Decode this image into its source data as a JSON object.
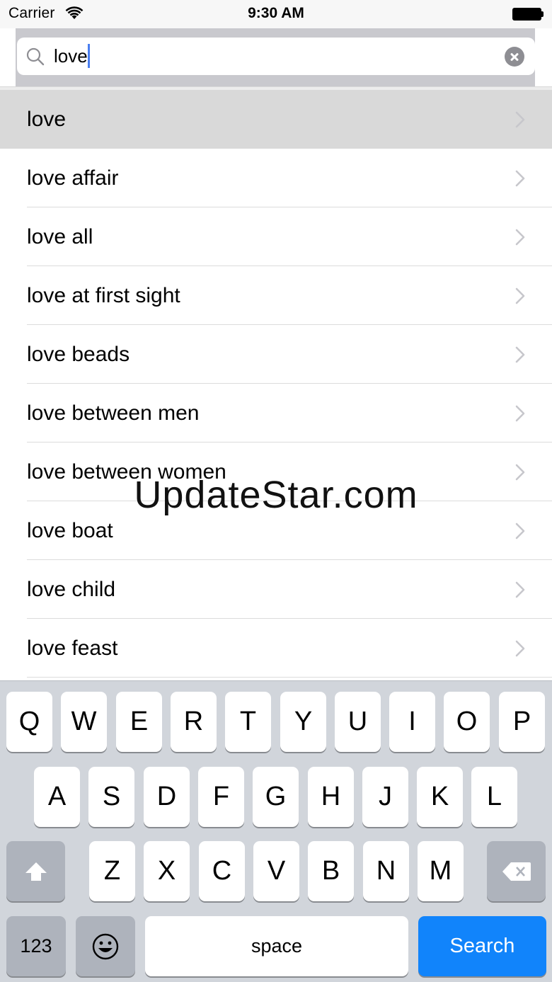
{
  "status_bar": {
    "carrier": "Carrier",
    "time": "9:30 AM"
  },
  "search": {
    "query": "love"
  },
  "suggestions": [
    {
      "label": "love",
      "selected": true
    },
    {
      "label": "love affair"
    },
    {
      "label": "love all"
    },
    {
      "label": "love at first sight"
    },
    {
      "label": "love beads"
    },
    {
      "label": "love between men"
    },
    {
      "label": "love between women"
    },
    {
      "label": "love boat"
    },
    {
      "label": "love child"
    },
    {
      "label": "love feast"
    }
  ],
  "watermark": "UpdateStar.com",
  "keyboard": {
    "row1": [
      "Q",
      "W",
      "E",
      "R",
      "T",
      "Y",
      "U",
      "I",
      "O",
      "P"
    ],
    "row2": [
      "A",
      "S",
      "D",
      "F",
      "G",
      "H",
      "J",
      "K",
      "L"
    ],
    "row3": [
      "Z",
      "X",
      "C",
      "V",
      "B",
      "N",
      "M"
    ],
    "numbers_label": "123",
    "space_label": "space",
    "search_label": "Search"
  },
  "colors": {
    "accent": "#1184fb",
    "selected_row": "#d9d9d9",
    "keyboard_bg": "#d1d5db"
  }
}
